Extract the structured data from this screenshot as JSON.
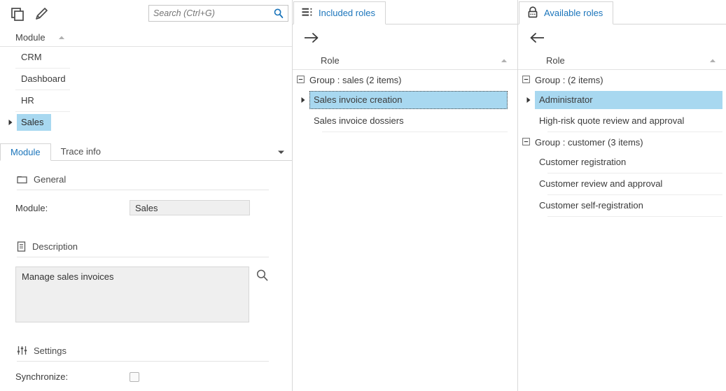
{
  "left": {
    "toolbar": {
      "copy_icon": "copy-icon",
      "edit_icon": "pencil-icon"
    },
    "search": {
      "placeholder": "Search (Ctrl+G)",
      "value": "",
      "icon": "search-icon"
    },
    "grid": {
      "column_header": "Module",
      "sort_icon": "sort-ascending-icon",
      "rows": [
        {
          "label": "CRM",
          "selected": false,
          "expandable": false
        },
        {
          "label": "Dashboard",
          "selected": false,
          "expandable": false
        },
        {
          "label": "HR",
          "selected": false,
          "expandable": false
        },
        {
          "label": "Sales",
          "selected": true,
          "expandable": true
        }
      ]
    },
    "form": {
      "tabs": [
        {
          "label": "Module",
          "active": true
        },
        {
          "label": "Trace info",
          "active": false
        }
      ],
      "tabs_overflow_icon": "chevron-down-icon",
      "sections": {
        "general": {
          "title": "General",
          "icon": "folder-icon"
        },
        "description": {
          "title": "Description",
          "icon": "document-icon"
        },
        "settings": {
          "title": "Settings",
          "icon": "sliders-icon"
        }
      },
      "module_field": {
        "label": "Module:",
        "value": "Sales"
      },
      "description_field": {
        "value": "Manage sales invoices",
        "lookup_icon": "search-icon"
      },
      "synchronize_field": {
        "label": "Synchronize:",
        "checked": false
      }
    }
  },
  "middle": {
    "tab": {
      "label": "Included roles",
      "icon": "list-icon"
    },
    "move_button": {
      "icon": "arrow-right-icon"
    },
    "column_header": "Role",
    "sort_icon": "sort-ascending-icon",
    "groups": [
      {
        "label": "Group : sales (2 items)",
        "collapse_icon": "minus-box-icon",
        "items": [
          {
            "label": "Sales invoice creation",
            "selected": true,
            "expandable": true
          },
          {
            "label": "Sales invoice dossiers",
            "selected": false,
            "expandable": false
          }
        ]
      }
    ]
  },
  "right": {
    "tab": {
      "label": "Available roles",
      "icon": "lock-icon"
    },
    "move_button": {
      "icon": "arrow-left-icon"
    },
    "column_header": "Role",
    "sort_icon": "sort-ascending-icon",
    "groups": [
      {
        "label": "Group :  (2 items)",
        "collapse_icon": "minus-box-icon",
        "items": [
          {
            "label": "Administrator",
            "selected": true,
            "expandable": true
          },
          {
            "label": "High-risk quote review and approval",
            "selected": false,
            "expandable": false
          }
        ]
      },
      {
        "label": "Group : customer (3 items)",
        "collapse_icon": "minus-box-icon",
        "items": [
          {
            "label": "Customer registration",
            "selected": false,
            "expandable": false
          },
          {
            "label": "Customer review and approval",
            "selected": false,
            "expandable": false
          },
          {
            "label": "Customer self-registration",
            "selected": false,
            "expandable": false
          }
        ]
      }
    ]
  },
  "colors": {
    "selection": "#a8d8f0",
    "tab_text": "#1b75bb",
    "accent": "#1b75bb",
    "field_bg": "#efefef"
  }
}
